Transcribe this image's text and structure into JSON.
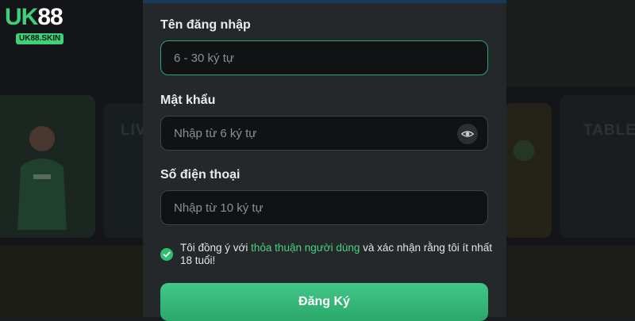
{
  "logo": {
    "brand_prefix": "UK",
    "brand_suffix": "88",
    "domain": "UK88.SKIN"
  },
  "background": {
    "live_label": "LIV",
    "table_label": "TABLE"
  },
  "form": {
    "username": {
      "label": "Tên đăng nhập",
      "placeholder": "6 - 30 ký tự"
    },
    "password": {
      "label": "Mật khẩu",
      "placeholder": "Nhập từ 6 ký tự",
      "toggle_icon": "eye-icon"
    },
    "phone": {
      "label": "Số điện thoại",
      "placeholder": "Nhập từ 10 ký tự"
    },
    "agreement": {
      "checked": true,
      "prefix": "Tôi đồng ý với ",
      "link": "thỏa thuận người dùng",
      "suffix": " và xác nhận rằng tôi ít nhất 18 tuổi!"
    },
    "submit_label": "Đăng Ký"
  },
  "colors": {
    "accent": "#2fbf6e",
    "panel": "#25282a",
    "input_bg": "#101213"
  }
}
